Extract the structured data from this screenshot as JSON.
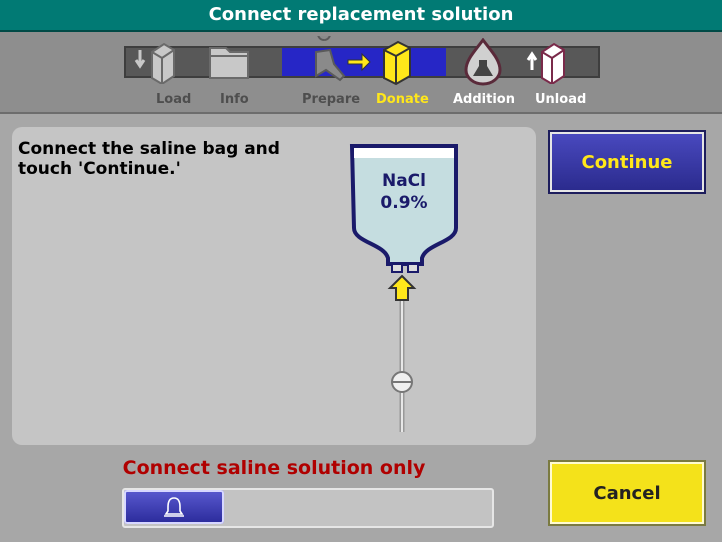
{
  "title": "Connect replacement solution",
  "steps": {
    "load": "Load",
    "info": "Info",
    "prepare": "Prepare",
    "donate": "Donate",
    "addition": "Addition",
    "unload": "Unload"
  },
  "instruction": "Connect the saline bag and touch 'Continue.'",
  "bag": {
    "line1": "NaCl",
    "line2": "0.9%"
  },
  "continue_label": "Continue",
  "cancel_label": "Cancel",
  "warning": "Connect saline solution only",
  "colors": {
    "title_bg": "#017a74",
    "active_step": "#2626c6",
    "current_step_text": "#ffe71a",
    "warning": "#b00000",
    "cancel_bg": "#f4e21a"
  },
  "icons": [
    "load-icon",
    "info-folder-icon",
    "donor-icon",
    "donate-bag-icon",
    "addition-flask-icon",
    "unload-icon",
    "bell-icon"
  ]
}
